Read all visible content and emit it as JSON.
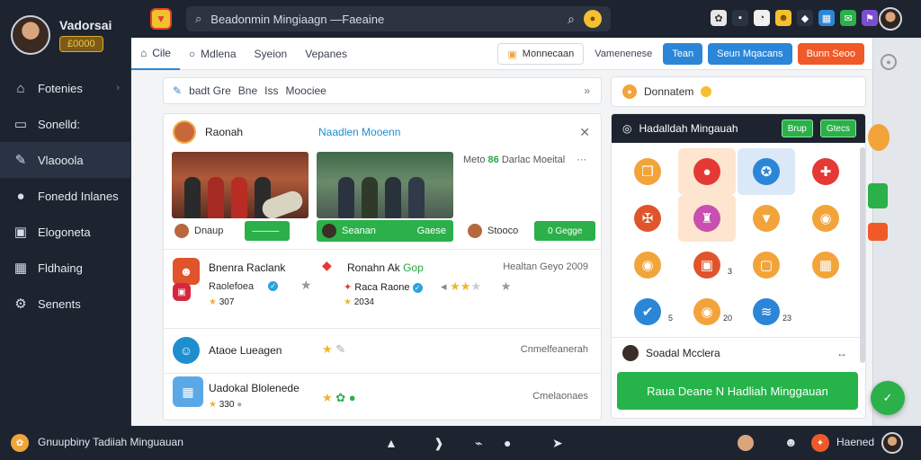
{
  "profile": {
    "name": "Vadorsai",
    "badge": "£0000"
  },
  "sidebar": {
    "items": [
      {
        "label": "Fotenies",
        "icon": "house-icon"
      },
      {
        "label": "Sonelld:",
        "icon": "layout-icon"
      },
      {
        "label": "Vlaooola",
        "icon": "pencil-icon"
      },
      {
        "label": "Fonedd Inlanes",
        "icon": "user-icon"
      },
      {
        "label": "Elogoneta",
        "icon": "card-icon"
      },
      {
        "label": "Fldhaing",
        "icon": "building-icon"
      },
      {
        "label": "Senents",
        "icon": "gear-icon"
      }
    ]
  },
  "search": {
    "value": "Beadonmin Mingiaagn —Faeaine"
  },
  "tabs": [
    "Cile",
    "Mdlena",
    "Syeion",
    "Vepanes"
  ],
  "top_actions": {
    "outline_label": "Monnecaan",
    "link_label": "Vamenenese",
    "btn1": "Tean",
    "btn2": "Seun Mqacans",
    "btn3": "Bunn Seoo"
  },
  "filter": {
    "items": [
      "badt Gre",
      "Bne",
      "Iss",
      "Moociee"
    ]
  },
  "feed": {
    "header_title": "Raonah",
    "header_title2": "Naadlen Mooenn",
    "side_note": {
      "text": "Meto",
      "highlight": "86",
      "rest": "Darlac Moeital"
    },
    "media1_caption": "",
    "pill_left_label": "Dnaup",
    "pill_left_btn": "———",
    "pill_mid_label": "Seanan",
    "pill_mid_btn": "Gaese",
    "pill_right_label": "Stooco",
    "pill_right_btn": "0 Gegge",
    "rows": [
      {
        "title": "Bnenra Raclank",
        "sub": "Raolefoea",
        "meta": "307",
        "mid_title": "Ronahn Ak",
        "mid_tag": "Gop",
        "mid_sub": "Raca Raone",
        "mid_meta": "2034",
        "right": "Healtan Geyo 2009"
      },
      {
        "title": "Ataoe Lueagen",
        "right": "Cnmelfeanerah"
      },
      {
        "title": "Uadokal Blolenede",
        "meta": "330",
        "right": "Cmelaonaes"
      }
    ]
  },
  "gifts": {
    "top_label": "Donnatem",
    "title": "Hadalldah Mingauah",
    "btn1": "Brup",
    "btn2": "Gtecs",
    "items": [
      {
        "icon": "gift-box-icon",
        "count": "",
        "color": "#f2a43a"
      },
      {
        "icon": "balloon-icon",
        "count": "",
        "color": "#e53935"
      },
      {
        "icon": "ribbon-icon",
        "count": "",
        "color": "#2b86d8"
      },
      {
        "icon": "badge-icon",
        "count": "",
        "color": "#e53935"
      },
      {
        "icon": "crest-icon",
        "count": "",
        "color": "#e0542c"
      },
      {
        "icon": "cake-icon",
        "count": "",
        "color": "#c94fb0"
      },
      {
        "icon": "basket-icon",
        "count": "",
        "color": "#f2a43a"
      },
      {
        "icon": "coin-icon",
        "count": "",
        "color": "#f2a43a"
      },
      {
        "icon": "coin-icon",
        "count": "",
        "color": "#f2a43a"
      },
      {
        "icon": "present-icon",
        "count": "3",
        "color": "#e0542c"
      },
      {
        "icon": "frame-icon",
        "count": "",
        "color": "#f2a43a"
      },
      {
        "icon": "chest-icon",
        "count": "",
        "color": "#f2a43a"
      },
      {
        "icon": "check-icon",
        "count": "5",
        "color": "#2b86d8"
      },
      {
        "icon": "coin-icon",
        "count": "20",
        "color": "#f2a43a"
      },
      {
        "icon": "signal-icon",
        "count": "23",
        "color": "#2b86d8"
      },
      {
        "icon": "empty",
        "count": "",
        "color": "#ffffff"
      }
    ],
    "footer_label": "Soadal Mcclera",
    "claim_label": "Raua Deane N Hadliah Minggauan"
  },
  "bottombar": {
    "label": "Gnuupbiny Tadiiah Minguauan",
    "right_label": "Haened"
  },
  "colors": {
    "dark": "#1d2430",
    "green": "#2bb04a",
    "blue": "#2b86d8",
    "orange": "#f05a28",
    "accent_gold": "#f2c12e"
  }
}
